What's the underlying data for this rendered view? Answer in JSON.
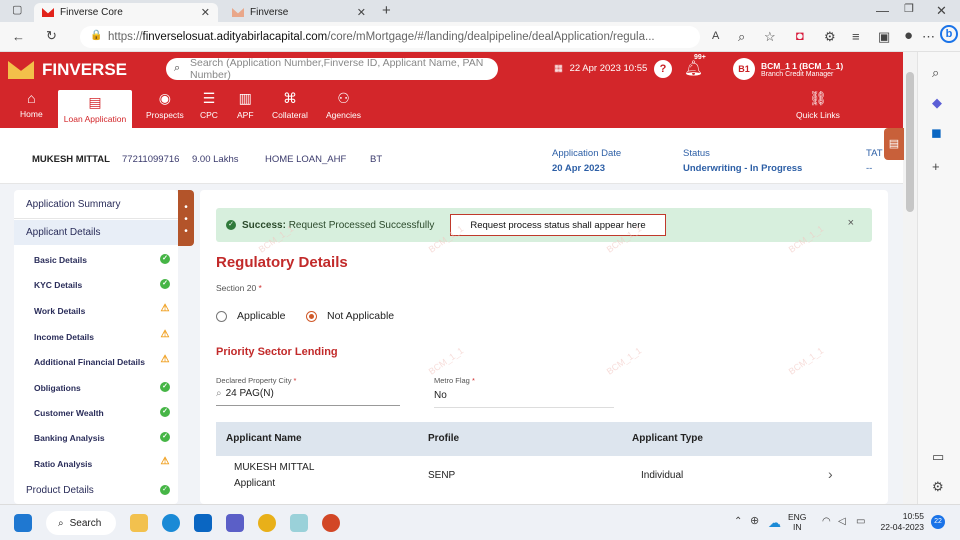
{
  "browser": {
    "tabs": [
      {
        "label": "Finverse Core"
      },
      {
        "label": "Finverse"
      }
    ],
    "url_prefix": "https://",
    "url_host": "finverselosuat.adityabirlacapital.com",
    "url_path": "/core/mMortgage/#/landing/dealpipeline/dealApplication/regula...",
    "new_tab": "+"
  },
  "app": {
    "brand": "FINVERSE",
    "search_placeholder": "Search (Application Number,Finverse ID, Applicant Name, PAN Number)",
    "datetime": "22 Apr 2023 10:55",
    "notif_count": "99+",
    "user_initials": "B1",
    "user_name": "BCM_1 1 (BCM_1_1)",
    "user_role": "Branch Credit Manager",
    "nav": [
      {
        "label": "Home",
        "icon": "home-icon"
      },
      {
        "label": "Loan Application",
        "icon": "application-icon"
      },
      {
        "label": "Prospects",
        "icon": "prospects-icon"
      },
      {
        "label": "CPC",
        "icon": "cpc-icon"
      },
      {
        "label": "APF",
        "icon": "apf-icon"
      },
      {
        "label": "Collateral",
        "icon": "collateral-icon"
      },
      {
        "label": "Agencies",
        "icon": "agencies-icon"
      }
    ],
    "quick_links": "Quick Links"
  },
  "strip": {
    "name": "MUKESH MITTAL",
    "phone": "77211099716",
    "amount": "9.00 Lakhs",
    "product": "HOME LOAN_AHF",
    "type": "BT",
    "app_date_label": "Application Date",
    "app_date": "20 Apr 2023",
    "status_label": "Status",
    "status": "Underwriting - In Progress",
    "tat_label": "TAT",
    "tat": "--"
  },
  "sidebar": {
    "sections": [
      {
        "label": "Application Summary"
      },
      {
        "label": "Applicant Details"
      }
    ],
    "items": [
      {
        "label": "Basic Details",
        "status": "ok"
      },
      {
        "label": "KYC Details",
        "status": "ok"
      },
      {
        "label": "Work Details",
        "status": "warn"
      },
      {
        "label": "Income Details",
        "status": "warn"
      },
      {
        "label": "Additional Financial Details",
        "status": "warn"
      },
      {
        "label": "Obligations",
        "status": "ok"
      },
      {
        "label": "Customer Wealth",
        "status": "ok"
      },
      {
        "label": "Banking Analysis",
        "status": "ok"
      },
      {
        "label": "Ratio Analysis",
        "status": "warn"
      }
    ],
    "product_details": "Product Details"
  },
  "main": {
    "toast_bold": "Success:",
    "toast_text": "Request Processed Successfully",
    "toast_close": "×",
    "annotation": "Request process status shall appear here",
    "title": "Regulatory Details",
    "section20": "Section 20",
    "required": "*",
    "opt_applicable": "Applicable",
    "opt_not_applicable": "Not Applicable",
    "psl_title": "Priority Sector Lending",
    "city_label": "Declared Property City",
    "city_value": "24 PAG(N)",
    "metro_label": "Metro Flag",
    "metro_value": "No",
    "table": {
      "headers": [
        "Applicant Name",
        "Profile",
        "Applicant Type"
      ],
      "row": {
        "name": "MUKESH MITTAL",
        "role": "Applicant",
        "profile": "SENP",
        "type": "Individual"
      }
    },
    "watermark": "BCM_1_1"
  },
  "taskbar": {
    "search": "Search",
    "lang_top": "ENG",
    "lang_bottom": "IN",
    "time": "10:55",
    "date": "22-04-2023",
    "badge": "22"
  }
}
